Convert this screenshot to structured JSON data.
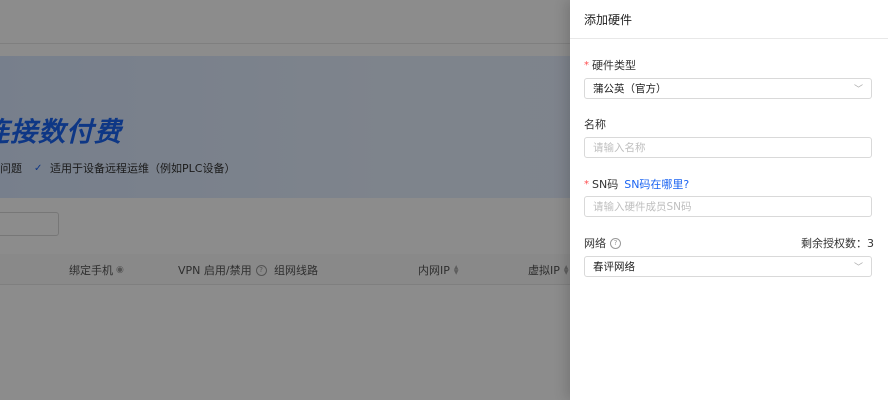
{
  "background": {
    "banner_title": "连接数付费",
    "feature_1": "问题",
    "feature_2": "适用于设备远程运维（例如PLC设备）",
    "table_headers": {
      "bound_phone": "绑定手机",
      "vpn": "VPN 启用/禁用",
      "route": "组网线路",
      "intranet_ip": "内网IP",
      "virtual_ip": "虚拟IP"
    }
  },
  "drawer": {
    "title": "添加硬件",
    "hardware_type": {
      "label": "硬件类型",
      "value": "蒲公英（官方）"
    },
    "name": {
      "label": "名称",
      "placeholder": "请输入名称"
    },
    "sn": {
      "label": "SN码",
      "link": "SN码在哪里?",
      "placeholder": "请输入硬件成员SN码"
    },
    "network": {
      "label": "网络",
      "quota": "剩余授权数：3",
      "value": "春评网络"
    }
  },
  "colors": {
    "accent": "#1b64f2",
    "required": "#ff4d4f"
  },
  "icons": [
    "check-icon",
    "eye-icon",
    "help-icon",
    "sort-icon",
    "chevron-down-icon"
  ]
}
